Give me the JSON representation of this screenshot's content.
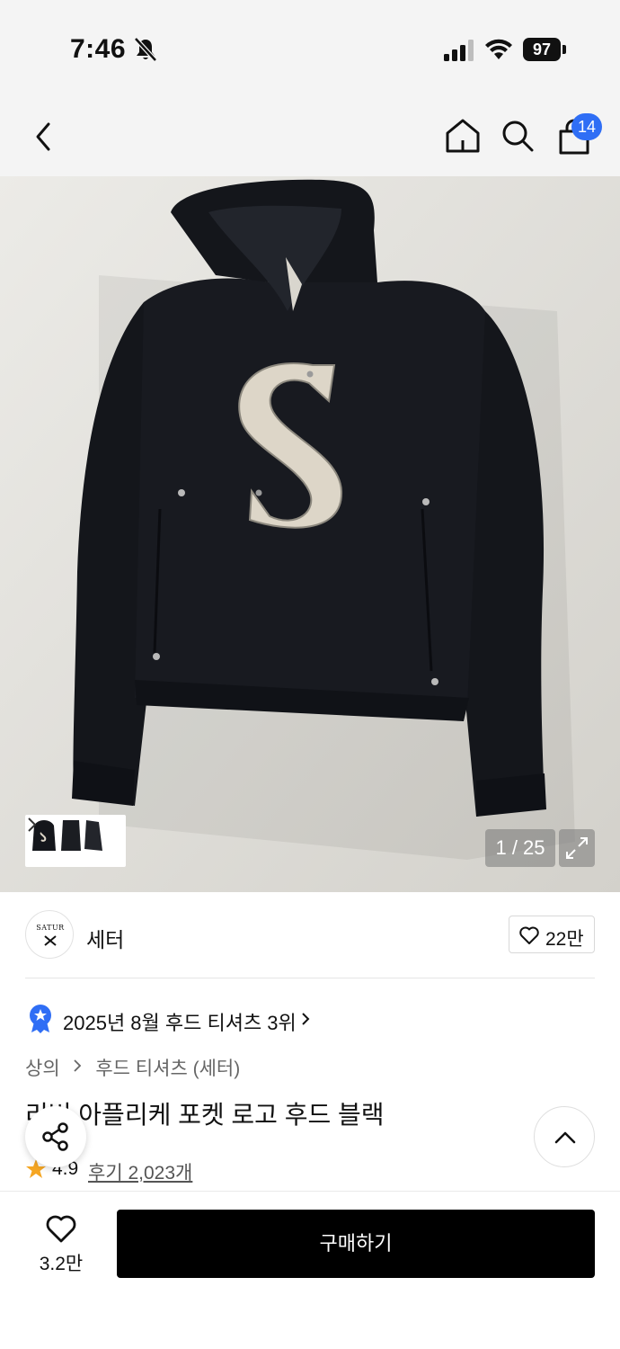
{
  "status_bar": {
    "time": "7:46",
    "battery": "97"
  },
  "nav": {
    "cart_count": "14"
  },
  "gallery": {
    "counter": "1 / 25"
  },
  "brand": {
    "logo_text": "SATUR",
    "name": "세터",
    "likes": "22만"
  },
  "ranking": {
    "text": "2025년 8월 후드 티셔츠 3위"
  },
  "breadcrumb": {
    "category": "상의",
    "subcategory": "후드 티셔츠 (세터)"
  },
  "product": {
    "title": "리버 아플리케 포켓 로고 후드 블랙",
    "rating": "4.9",
    "reviews": "후기 2,023개"
  },
  "bottom_bar": {
    "wish_count": "3.2만",
    "buy_label": "구매하기"
  },
  "colors": {
    "accent_blue": "#2f6ef5",
    "star": "#f5a623",
    "buy_button": "#000000",
    "hoodie": "#14161b",
    "logo_patch": "#ddd6c8"
  }
}
